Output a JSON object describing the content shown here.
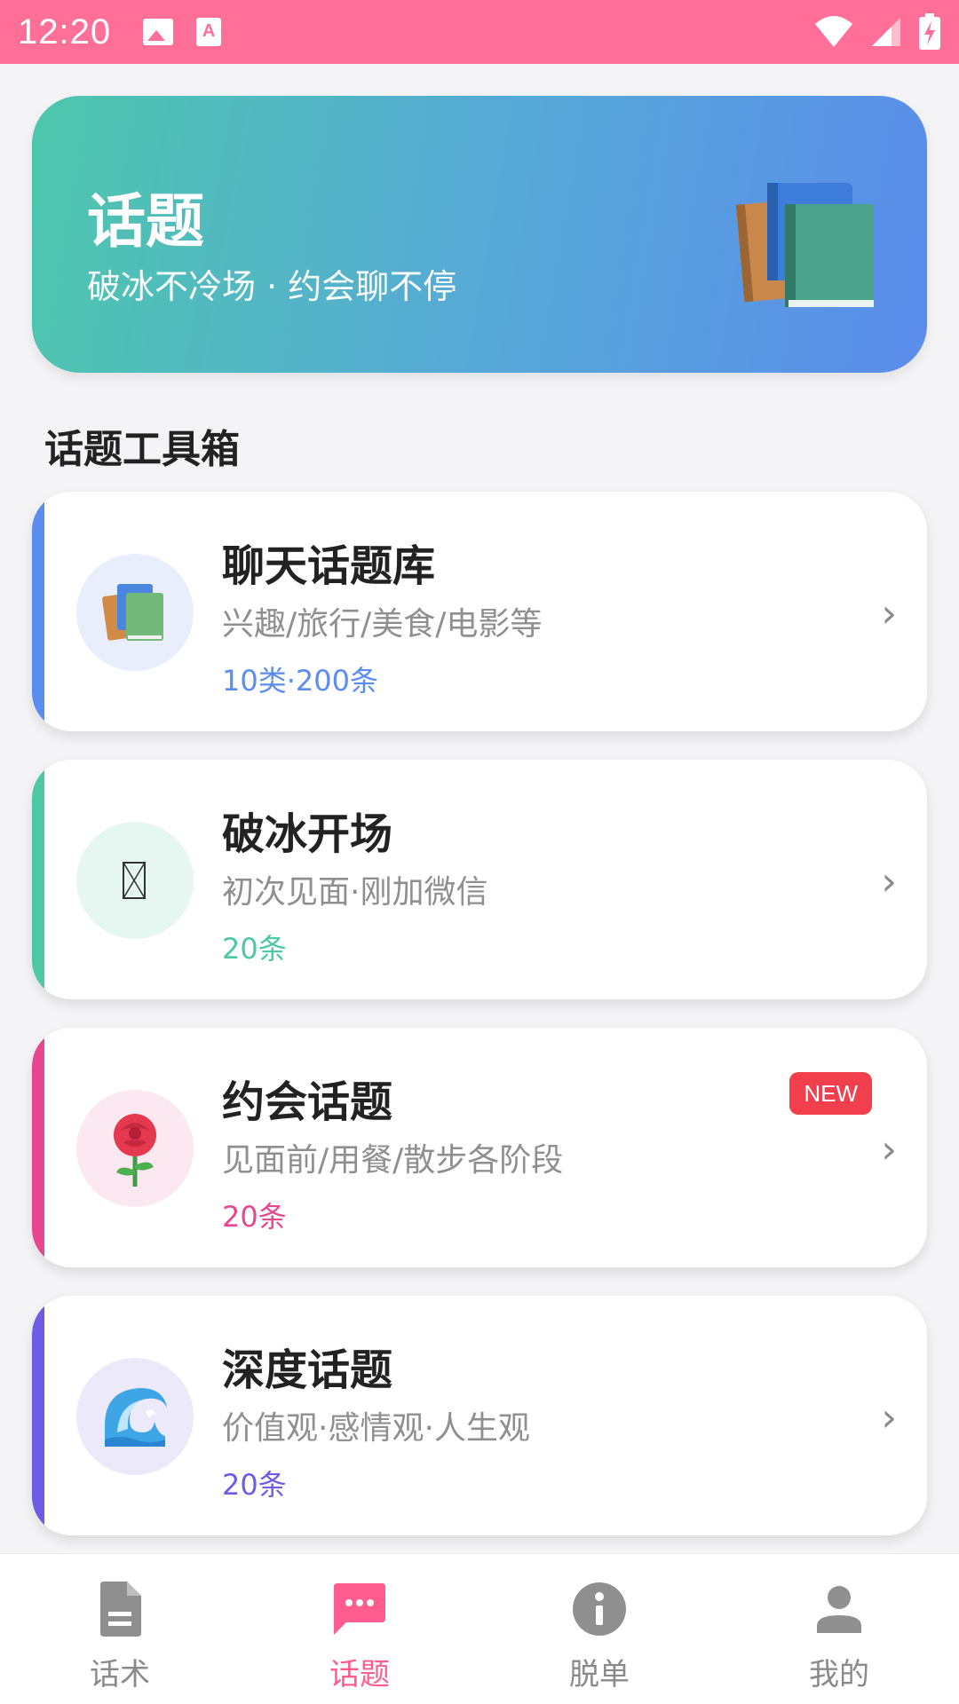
{
  "status_bar": {
    "time": "12:20",
    "icons": [
      "image-notification-icon",
      "text-notification-icon",
      "wifi-icon",
      "signal-icon",
      "battery-charging-icon"
    ]
  },
  "hero": {
    "title": "话题",
    "subtitle": "破冰不冷场 · 约会聊不停",
    "icon": "books-icon"
  },
  "section": {
    "title": "话题工具箱"
  },
  "cards": [
    {
      "title": "聊天话题库",
      "desc": "兴趣/旅行/美食/电影等",
      "count": "10类·200条",
      "accent": "#5b8def",
      "icon_bg": "#e8eefc",
      "icon": "books-icon"
    },
    {
      "title": "破冰开场",
      "desc": "初次见面·刚加微信",
      "count": "20条",
      "accent": "#4cc9a4",
      "icon_bg": "#e6f6f1",
      "icon": "missing-glyph-icon"
    },
    {
      "title": "约会话题",
      "desc": "见面前/用餐/散步各阶段",
      "count": "20条",
      "badge": "NEW",
      "accent": "#e8468f",
      "icon_bg": "#fce8f1",
      "icon": "rose-icon"
    },
    {
      "title": "深度话题",
      "desc": "价值观·感情观·人生观",
      "count": "20条",
      "accent": "#6d5ce6",
      "icon_bg": "#ece9fb",
      "icon": "wave-icon"
    }
  ],
  "chevron": "›",
  "bottom_nav": [
    {
      "label": "话术",
      "icon": "document-icon",
      "active": false
    },
    {
      "label": "话题",
      "icon": "chat-bubble-icon",
      "active": true
    },
    {
      "label": "脱单",
      "icon": "info-icon",
      "active": false
    },
    {
      "label": "我的",
      "icon": "person-icon",
      "active": false
    }
  ],
  "colors": {
    "status_bar": "#ff6f98",
    "active_nav": "#ff5d8f",
    "inactive_nav": "#8a8a8a",
    "badge": "#f23f4d"
  }
}
